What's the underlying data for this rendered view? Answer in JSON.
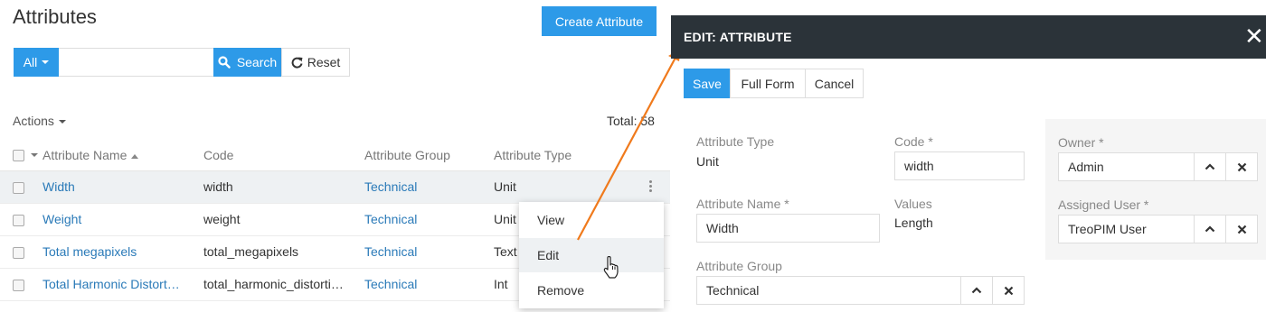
{
  "list": {
    "title": "Attributes",
    "create_label": "Create Attribute",
    "filter_all_label": "All",
    "search_value": "",
    "search_label": "Search",
    "reset_label": "Reset",
    "actions_label": "Actions",
    "total_label": "Total: 58",
    "columns": [
      "Attribute Name",
      "Code",
      "Attribute Group",
      "Attribute Type"
    ],
    "rows": [
      {
        "name": "Width",
        "code": "width",
        "group": "Technical",
        "type": "Unit"
      },
      {
        "name": "Weight",
        "code": "weight",
        "group": "Technical",
        "type": "Unit"
      },
      {
        "name": "Total megapixels",
        "code": "total_megapixels",
        "group": "Technical",
        "type": "Text"
      },
      {
        "name": "Total Harmonic Distort…",
        "code": "total_harmonic_distorti…",
        "group": "Technical",
        "type": "Int"
      }
    ],
    "row_menu": [
      "View",
      "Edit",
      "Remove"
    ]
  },
  "modal": {
    "title": "EDIT: ATTRIBUTE",
    "save_label": "Save",
    "full_form_label": "Full Form",
    "cancel_label": "Cancel",
    "fields": {
      "attribute_type_label": "Attribute Type",
      "attribute_type_value": "Unit",
      "code_label": "Code *",
      "code_value": "width",
      "attribute_name_label": "Attribute Name *",
      "attribute_name_value": "Width",
      "values_label": "Values",
      "values_value": "Length",
      "attribute_group_label": "Attribute Group",
      "attribute_group_value": "Technical",
      "owner_label": "Owner *",
      "owner_value": "Admin",
      "assigned_user_label": "Assigned User *",
      "assigned_user_value": "TreoPIM User"
    }
  },
  "colors": {
    "primary": "#2d9ae8",
    "link": "#2a7ab8",
    "modal_header": "#2b3339",
    "annotation_arrow": "#f07a1c"
  },
  "icons": [
    "search-icon",
    "reset-icon",
    "close-icon",
    "chevron-up-icon",
    "clear-x-icon",
    "kebab-icon",
    "hand-cursor-icon"
  ]
}
